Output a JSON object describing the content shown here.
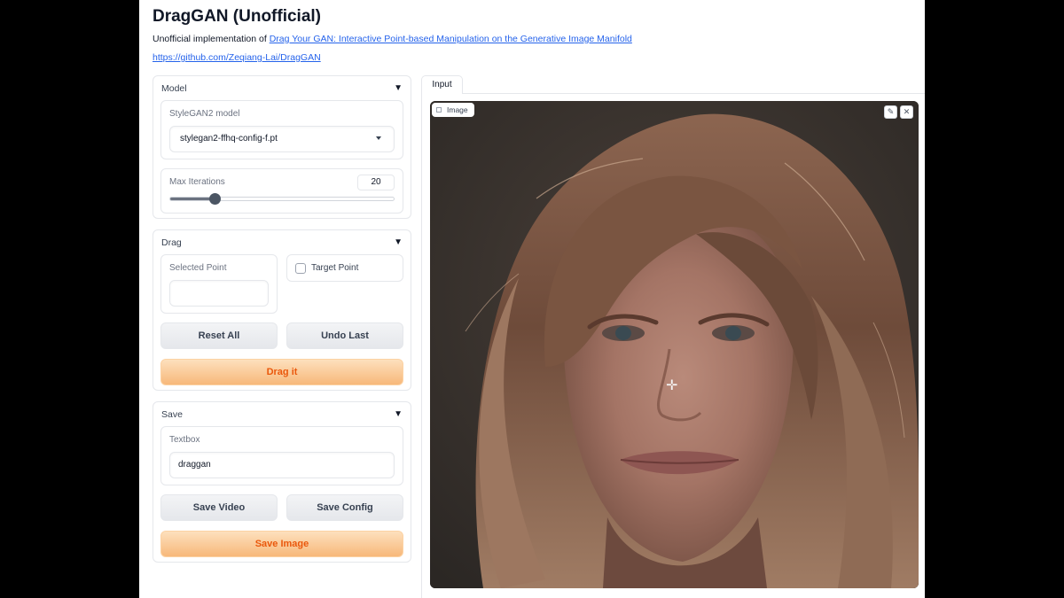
{
  "app": {
    "title": "DragGAN (Unofficial)",
    "description_prefix": "Unofficial implementation of ",
    "paper_link_text": "Drag Your GAN: Interactive Point-based Manipulation on the Generative Image Manifold",
    "repo_link_text": "https://github.com/Zeqiang-Lai/DragGAN"
  },
  "model_panel": {
    "header": "Model",
    "model_label": "StyleGAN2 model",
    "model_value": "stylegan2-ffhq-config-f.pt",
    "iterations_label": "Max Iterations",
    "iterations_value": "20",
    "iterations_fraction": 0.2
  },
  "drag_panel": {
    "header": "Drag",
    "selected_point_label": "Selected Point",
    "selected_point_value": "",
    "target_point_label": "Target Point",
    "reset_label": "Reset All",
    "undo_label": "Undo Last",
    "drag_label": "Drag it"
  },
  "save_panel": {
    "header": "Save",
    "textbox_label": "Textbox",
    "textbox_value": "draggan",
    "save_video_label": "Save Video",
    "save_config_label": "Save Config",
    "save_image_label": "Save Image"
  },
  "input_tab": {
    "tab_label": "Input",
    "image_label": "Image",
    "edit_icon": "pencil-icon",
    "close_icon": "close-icon"
  },
  "colors": {
    "primary_text": "#ea580c",
    "primary_bg": "#fdd0a2",
    "link": "#2563eb"
  }
}
